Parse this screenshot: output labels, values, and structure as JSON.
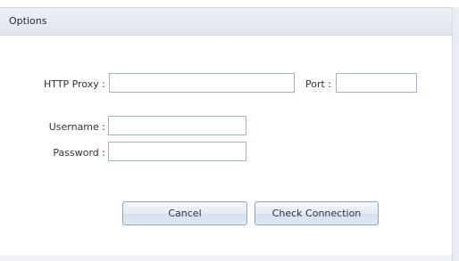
{
  "window": {
    "title": "Options"
  },
  "form": {
    "proxy_label": "HTTP Proxy :",
    "proxy_value": "",
    "port_label": "Port :",
    "port_value": "",
    "username_label": "Username :",
    "username_value": "",
    "password_label": "Password :",
    "password_value": ""
  },
  "buttons": {
    "cancel_label": "Cancel",
    "check_connection_label": "Check Connection"
  }
}
